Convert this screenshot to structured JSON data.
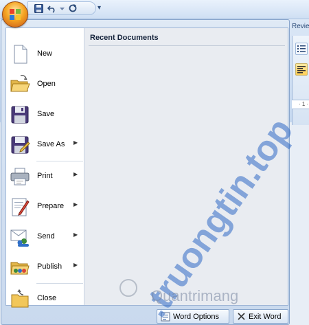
{
  "app": {
    "ribbon_tab_partial": "Revie",
    "ruler_partial": "· 1 ·"
  },
  "quick_access": {
    "items": [
      "save-icon",
      "undo-icon",
      "undo-dropdown-icon",
      "redo-icon"
    ],
    "customize_glyph": "▾"
  },
  "menu": {
    "items": [
      {
        "label": "New",
        "icon": "new-document-icon",
        "submenu": false
      },
      {
        "label": "Open",
        "icon": "open-folder-icon",
        "submenu": false
      },
      {
        "label": "Save",
        "icon": "save-disk-icon",
        "submenu": false
      },
      {
        "label": "Save As",
        "icon": "save-as-icon",
        "submenu": true
      },
      {
        "label": "Print",
        "icon": "printer-icon",
        "submenu": true
      },
      {
        "label": "Prepare",
        "icon": "prepare-icon",
        "submenu": true
      },
      {
        "label": "Send",
        "icon": "send-icon",
        "submenu": true
      },
      {
        "label": "Publish",
        "icon": "publish-icon",
        "submenu": true
      },
      {
        "label": "Close",
        "icon": "close-folder-icon",
        "submenu": false
      }
    ],
    "arrow_glyph": "▶",
    "recent_title": "Recent Documents",
    "footer": {
      "options_label": "Word Options",
      "exit_label": "Exit Word"
    }
  },
  "watermark": {
    "text": ".truongtin.top",
    "sub": "Quantrimang"
  },
  "colors": {
    "accent": "#2b579a",
    "menu_frame": "#c9d9ee",
    "recent_pane": "#e9ecf1"
  }
}
